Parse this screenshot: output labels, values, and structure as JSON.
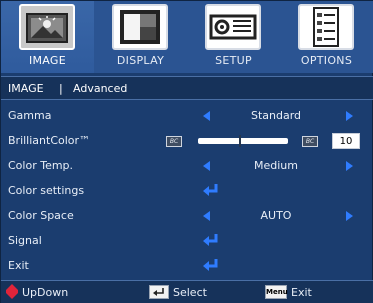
{
  "tabs": [
    {
      "label": "IMAGE",
      "active": true,
      "icon": "image-tab-icon"
    },
    {
      "label": "DISPLAY",
      "active": false,
      "icon": "display-tab-icon"
    },
    {
      "label": "SETUP",
      "active": false,
      "icon": "setup-tab-icon"
    },
    {
      "label": "OPTIONS",
      "active": false,
      "icon": "options-tab-icon"
    }
  ],
  "breadcrumb": {
    "section": "IMAGE",
    "separator": "|",
    "subsection": "Advanced"
  },
  "rows": {
    "gamma": {
      "label": "Gamma",
      "value": "Standard"
    },
    "brilliant": {
      "label": "BrilliantColor™",
      "value": "10",
      "slider_min_icon": "BC",
      "slider_max_icon": "BC",
      "slider_level": 0.47
    },
    "color_temp": {
      "label": "Color Temp.",
      "value": "Medium"
    },
    "color_settings": {
      "label": "Color settings"
    },
    "color_space": {
      "label": "Color Space",
      "value": "AUTO"
    },
    "signal": {
      "label": "Signal"
    },
    "exit": {
      "label": "Exit"
    }
  },
  "footer": {
    "updown": "UpDown",
    "select": "Select",
    "menu_key": "Menu",
    "exit": "Exit"
  },
  "colors": {
    "background": "#1b3d6f",
    "tabbar": "#2b5492",
    "accent_arrow": "#2f7cff",
    "updown_icon": "#e0243a"
  }
}
